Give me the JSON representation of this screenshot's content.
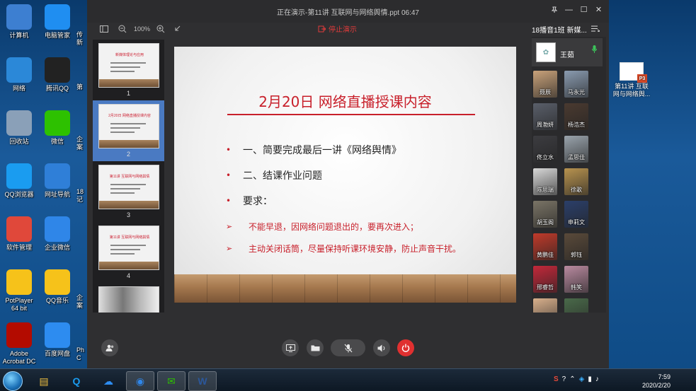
{
  "desktop_icons": [
    {
      "label": "计算机",
      "icon": "computer-icon",
      "color": "#3d7fd1"
    },
    {
      "label": "电脑管家",
      "icon": "tencent-pc-manager-icon",
      "color": "#1f8ef1"
    },
    {
      "label": "网络",
      "icon": "network-globe-icon",
      "color": "#2b88d8"
    },
    {
      "label": "腾讯QQ",
      "icon": "qq-penguin-icon",
      "color": "#222222"
    },
    {
      "label": "回收站",
      "icon": "recycle-bin-icon",
      "color": "#8aa0b8"
    },
    {
      "label": "微信",
      "icon": "wechat-icon",
      "color": "#2dc100"
    },
    {
      "label": "QQ浏览器",
      "icon": "qq-browser-icon",
      "color": "#1a9cf0"
    },
    {
      "label": "网址导航",
      "icon": "ie-browser-icon",
      "color": "#2f7fd8"
    },
    {
      "label": "软件管理",
      "icon": "software-manager-icon",
      "color": "#e0483a"
    },
    {
      "label": "企业微信",
      "icon": "wecom-icon",
      "color": "#2f86e8"
    },
    {
      "label": "PotPlayer\n64 bit",
      "icon": "potplayer-icon",
      "color": "#f6c21a"
    },
    {
      "label": "QQ音乐",
      "icon": "qq-music-icon",
      "color": "#f6c21a"
    },
    {
      "label": "Adobe\nAcrobat DC",
      "icon": "acrobat-icon",
      "color": "#b30b00"
    },
    {
      "label": "百度网盘",
      "icon": "baidu-netdisk-icon",
      "color": "#2d8cf0"
    }
  ],
  "desktop_partial_labels": [
    "传\n新",
    "第",
    "企\n案",
    "18\n记",
    "企\n案",
    "Ph\nC"
  ],
  "desktop_file": {
    "label": "第11讲  互联\n网与网络舆...",
    "badge": "P3"
  },
  "window": {
    "title": "正在演示-第11讲  互联网与网络舆情.ppt 06:47",
    "zoom": "100%",
    "stop_label": "停止演示"
  },
  "thumbnails": [
    {
      "num": "1",
      "title": "新媒体理论与应用",
      "active": false
    },
    {
      "num": "2",
      "title": "2月20日  网络直播授课内容",
      "active": true
    },
    {
      "num": "3",
      "title": "第11讲  互联网与网络舆情",
      "active": false
    },
    {
      "num": "4",
      "title": "第11讲  互联网与网络舆情",
      "active": false
    }
  ],
  "slide": {
    "title": "2月20日  网络直播授课内容",
    "bullets": [
      "一、简要完成最后一讲《网络舆情》",
      "二、结课作业问题",
      "要求："
    ],
    "subs": [
      "不能早退，因网络问题退出的，要再次进入；",
      "主动关闭话筒，尽量保持听课环境安静，防止声音干扰。"
    ]
  },
  "side": {
    "header": "18播音1班 新媒...",
    "host_name": "王茹",
    "members": [
      {
        "name": "聂辰",
        "color": "#c9a27a"
      },
      {
        "name": "马永光",
        "color": "#8a9bb0"
      },
      {
        "name": "周渤妍",
        "color": "#5a5f6a"
      },
      {
        "name": "杨浩杰",
        "color": "#4a3a30"
      },
      {
        "name": "佟立水",
        "color": "#3c3c40"
      },
      {
        "name": "孟思佳",
        "color": "#9aa4ad"
      },
      {
        "name": "陈思瑞",
        "color": "#d8d8d8"
      },
      {
        "name": "徐歌",
        "color": "#b8934f"
      },
      {
        "name": "胡玉阁",
        "color": "#7a7466"
      },
      {
        "name": "申莉文",
        "color": "#2b3f6a"
      },
      {
        "name": "黄鹏佳",
        "color": "#c03a2a"
      },
      {
        "name": "郭钰",
        "color": "#5a4a3a"
      },
      {
        "name": "邢睿哲",
        "color": "#c3283a"
      },
      {
        "name": "韩笑",
        "color": "#b98aa0"
      },
      {
        "name": "",
        "color": "#d9b08c"
      },
      {
        "name": "",
        "color": "#4a6a4a"
      }
    ]
  },
  "controls": [
    "member-list",
    "screen-share",
    "file",
    "microphone-muted",
    "speaker",
    "leave"
  ],
  "taskbar": {
    "apps": [
      {
        "icon": "file-explorer-icon",
        "color": "#f0c040",
        "active": false
      },
      {
        "icon": "qq-browser-task-icon",
        "color": "#1a9cf0",
        "active": false
      },
      {
        "icon": "baidu-netdisk-task-icon",
        "color": "#2d8cf0",
        "active": false
      },
      {
        "icon": "tencent-meeting-task-icon",
        "color": "#2f86e8",
        "active": true
      },
      {
        "icon": "wechat-task-icon",
        "color": "#2dc100",
        "active": true
      },
      {
        "icon": "word-task-icon",
        "color": "#2b579a",
        "active": true
      }
    ],
    "time": "7:59",
    "date": "2020/2/20"
  }
}
